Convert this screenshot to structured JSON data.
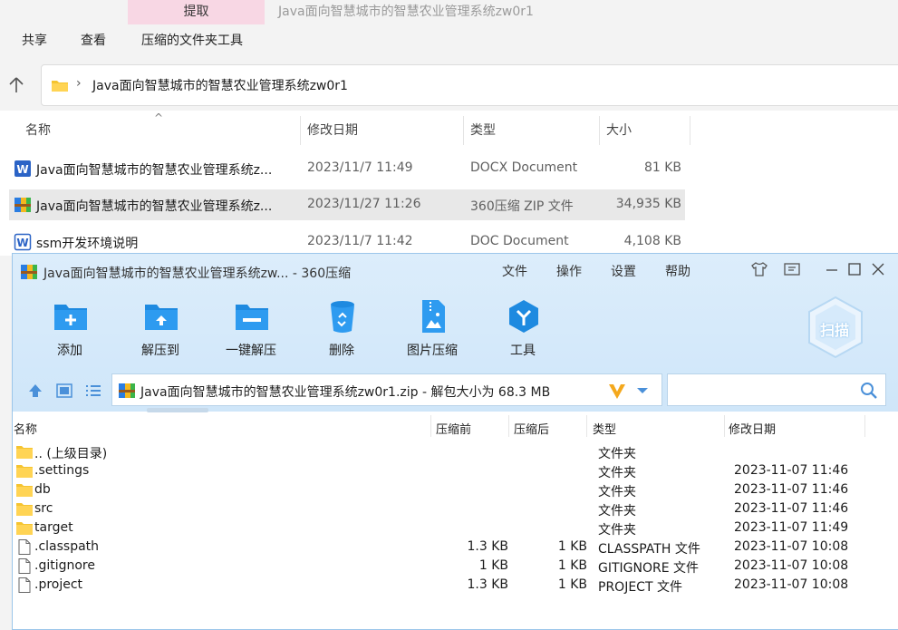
{
  "explorer": {
    "context_tab": "提取",
    "window_title": "Java面向智慧城市的智慧农业管理系统zw0r1",
    "ribbon_tabs": [
      "共享",
      "查看",
      "压缩的文件夹工具"
    ],
    "address_path": "Java面向智慧城市的智慧农业管理系统zw0r1",
    "columns": {
      "name": "名称",
      "date": "修改日期",
      "type": "类型",
      "size": "大小"
    },
    "files": [
      {
        "name": "Java面向智慧城市的智慧农业管理系统z...",
        "date": "2023/11/7 11:49",
        "type": "DOCX Document",
        "size": "81 KB",
        "icon": "word-docx-icon"
      },
      {
        "name": "Java面向智慧城市的智慧农业管理系统z...",
        "date": "2023/11/27 11:26",
        "type": "360压缩 ZIP 文件",
        "size": "34,935 KB",
        "icon": "zip-archive-icon",
        "selected": true
      },
      {
        "name": "ssm开发环境说明",
        "date": "2023/11/7 11:42",
        "type": "DOC Document",
        "size": "4,108 KB",
        "icon": "word-doc-icon"
      }
    ]
  },
  "zip": {
    "title": "Java面向智慧城市的智慧农业管理系统zw... - 360压缩",
    "menu": [
      "文件",
      "操作",
      "设置",
      "帮助"
    ],
    "toolbar": [
      "添加",
      "解压到",
      "一键解压",
      "删除",
      "图片压缩",
      "工具"
    ],
    "scan_label": "扫描",
    "address": "Java面向智慧城市的智慧农业管理系统zw0r1.zip - 解包大小为 68.3 MB",
    "columns": {
      "name": "名称",
      "before": "压缩前",
      "after": "压缩后",
      "type": "类型",
      "date": "修改日期"
    },
    "rows": [
      {
        "name": ".. (上级目录)",
        "before": "",
        "after": "",
        "type": "文件夹",
        "date": "",
        "kind": "folder"
      },
      {
        "name": ".settings",
        "before": "",
        "after": "",
        "type": "文件夹",
        "date": "2023-11-07 11:46",
        "kind": "folder"
      },
      {
        "name": "db",
        "before": "",
        "after": "",
        "type": "文件夹",
        "date": "2023-11-07 11:46",
        "kind": "folder"
      },
      {
        "name": "src",
        "before": "",
        "after": "",
        "type": "文件夹",
        "date": "2023-11-07 11:46",
        "kind": "folder"
      },
      {
        "name": "target",
        "before": "",
        "after": "",
        "type": "文件夹",
        "date": "2023-11-07 11:49",
        "kind": "folder"
      },
      {
        "name": ".classpath",
        "before": "1.3 KB",
        "after": "1 KB",
        "type": "CLASSPATH 文件",
        "date": "2023-11-07 10:08",
        "kind": "file"
      },
      {
        "name": ".gitignore",
        "before": "1 KB",
        "after": "1 KB",
        "type": "GITIGNORE 文件",
        "date": "2023-11-07 10:08",
        "kind": "file"
      },
      {
        "name": ".project",
        "before": "1.3 KB",
        "after": "1 KB",
        "type": "PROJECT 文件",
        "date": "2023-11-07 10:08",
        "kind": "file"
      }
    ]
  },
  "colors": {
    "accent_blue": "#1e8ae0",
    "folder_yellow": "#f5c430",
    "selection_gray": "#e8e8e8",
    "context_pink": "#f8d7e4"
  }
}
